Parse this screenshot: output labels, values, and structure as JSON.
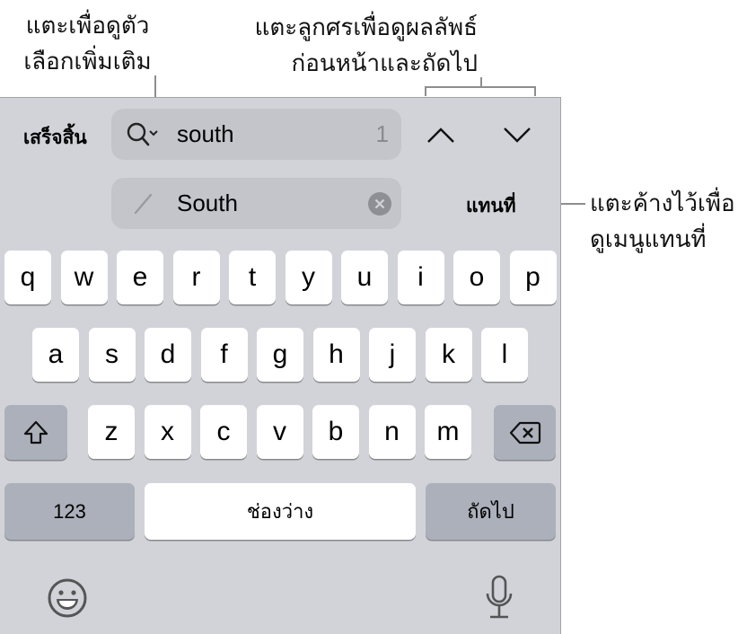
{
  "callouts": {
    "more_options": [
      "แตะเพื่อดูตัว",
      "เลือกเพิ่มเติม"
    ],
    "arrows": [
      "แตะลูกศรเพื่อดูผลลัพธ์",
      "ก่อนหน้าและถัดไป"
    ],
    "replace_menu": [
      "แตะค้างไว้เพื่อ",
      "ดูเมนูแทนที่"
    ]
  },
  "find_bar": {
    "done_label": "เสร็จสิ้น",
    "search_value": "south",
    "match_count": "1",
    "replace_value": "South",
    "replace_label": "แทนที่",
    "icons": {
      "search": "magnifier-with-chevron",
      "replace": "pencil",
      "clear": "x-circle",
      "prev": "chevron-up",
      "next": "chevron-down"
    }
  },
  "keyboard": {
    "row1": [
      "q",
      "w",
      "e",
      "r",
      "t",
      "y",
      "u",
      "i",
      "o",
      "p"
    ],
    "row2": [
      "a",
      "s",
      "d",
      "f",
      "g",
      "h",
      "j",
      "k",
      "l"
    ],
    "row3": [
      "z",
      "x",
      "c",
      "v",
      "b",
      "n",
      "m"
    ],
    "numbers_label": "123",
    "space_label": "ช่องว่าง",
    "next_label": "ถัดไป",
    "icons": {
      "shift": "shift-arrow",
      "delete": "backspace",
      "emoji": "smiley",
      "dictation": "microphone"
    }
  },
  "colors": {
    "keyboard_bg": "#d1d3d9",
    "key": "#ffffff",
    "special_key": "#abb0ba",
    "field": "#c3c5cb"
  }
}
